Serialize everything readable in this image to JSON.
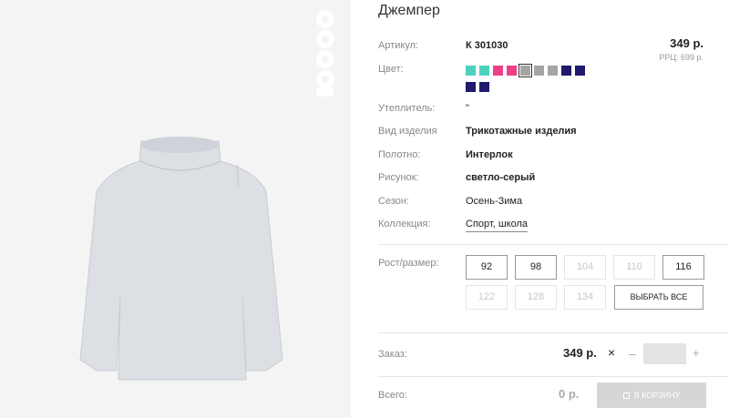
{
  "product": {
    "title": "Джемпер",
    "price": "349 р.",
    "rrc": "РРЦ: 699 р."
  },
  "details": {
    "article_label": "Артикул:",
    "article_value": "К 301030",
    "color_label": "Цвет:",
    "insulation_label": "Утеплитель:",
    "insulation_value": "\"",
    "type_label": "Вид изделия",
    "type_value": "Трикотажные изделия",
    "fabric_label": "Полотно:",
    "fabric_value": "Интерлок",
    "pattern_label": "Рисунок:",
    "pattern_value": "светло-серый",
    "season_label": "Сезон:",
    "season_value": "Осень-Зима",
    "collection_label": "Коллекция:",
    "collection_value": "Спорт, школа"
  },
  "colors": [
    {
      "hex": "#4fd1bd",
      "selected": false
    },
    {
      "hex": "#4fd1bd",
      "selected": false
    },
    {
      "hex": "#ef3f88",
      "selected": false
    },
    {
      "hex": "#ef3f88",
      "selected": false
    },
    {
      "hex": "#a5a5a5",
      "selected": true
    },
    {
      "hex": "#a5a5a5",
      "selected": false
    },
    {
      "hex": "#a5a5a5",
      "selected": false
    },
    {
      "hex": "#1f1a6b",
      "selected": false
    },
    {
      "hex": "#1f1a6b",
      "selected": false
    },
    {
      "hex": "#1f1a6b",
      "selected": false
    },
    {
      "hex": "#1f1a6b",
      "selected": false
    }
  ],
  "sizes": {
    "label": "Рост/размер:",
    "items": [
      {
        "label": "92",
        "available": true
      },
      {
        "label": "98",
        "available": true
      },
      {
        "label": "104",
        "available": false
      },
      {
        "label": "110",
        "available": false
      },
      {
        "label": "116",
        "available": true
      },
      {
        "label": "122",
        "available": false
      },
      {
        "label": "128",
        "available": false
      },
      {
        "label": "134",
        "available": false
      }
    ],
    "select_all_label": "ВЫБРАТЬ ВСЕ"
  },
  "order": {
    "label": "Заказ:",
    "price": "349 р.",
    "times_symbol": "×",
    "minus_symbol": "–",
    "plus_symbol": "+",
    "quantity": ""
  },
  "total": {
    "label": "Всего:",
    "value": "0 р.",
    "cart_button_label": "В КОРЗИНУ"
  },
  "brand": {
    "logo_text": "acoola"
  },
  "icons": {
    "cart": "cart-icon",
    "times": "times-icon",
    "minus": "minus-icon",
    "plus": "plus-icon"
  }
}
